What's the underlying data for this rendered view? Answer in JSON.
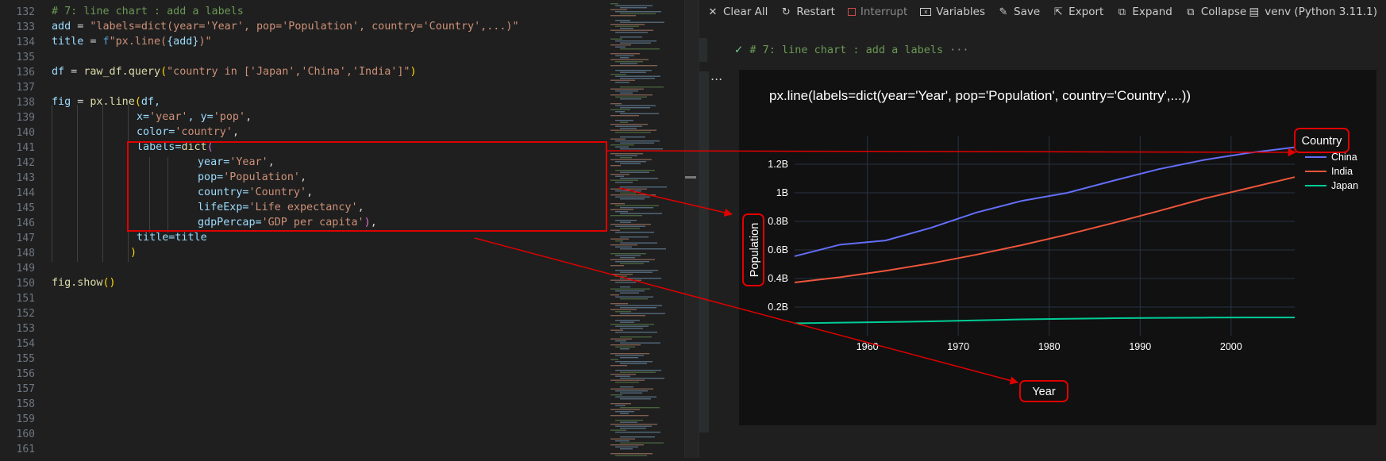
{
  "editor": {
    "line_numbers": [
      "132",
      "133",
      "134",
      "135",
      "136",
      "137",
      "138",
      "139",
      "140",
      "141",
      "142",
      "143",
      "144",
      "145",
      "146",
      "147",
      "148",
      "149",
      "150",
      "151",
      "152",
      "153",
      "154",
      "155",
      "156",
      "157",
      "158",
      "159",
      "160",
      "161"
    ],
    "lines": {
      "l132": "# 7: line chart : add a labels",
      "l133_var": "add",
      "l133_str": "\"labels=dict(year='Year', pop='Population', country='Country',...)\"",
      "l134_var": "title",
      "l134_f": "f",
      "l134_s1": "\"px.line(",
      "l134_in": "{add}",
      "l134_s2": ")\"",
      "l136_var": "df",
      "l136_fn": "raw_df.query",
      "l136_str": "\"country in ['Japan','China','India']\"",
      "l138_var": "fig",
      "l138_fn": "px.line",
      "l138_arg": "df,",
      "l139_x": "x=",
      "l139_xv": "'year'",
      "l139_y": ", y=",
      "l139_yv": "'pop'",
      "l139_end": ",",
      "l140_k": "color=",
      "l140_v": "'country'",
      "l141_k": "labels=",
      "l141_fn": "dict",
      "l142_k": "year=",
      "l142_v": "'Year'",
      "l143_k": "pop=",
      "l143_v": "'Population'",
      "l144_k": "country=",
      "l144_v": "'Country'",
      "l145_k": "lifeExp=",
      "l145_v": "'Life expectancy'",
      "l146_k": "gdpPercap=",
      "l146_v": "'GDP per capita'",
      "l147_k": "title=",
      "l147_v": "title",
      "l148": ")",
      "l150_fn": "fig.show"
    }
  },
  "toolbar": {
    "clear_all": "Clear All",
    "restart": "Restart",
    "interrupt": "Interrupt",
    "variables": "Variables",
    "save": "Save",
    "export": "Export",
    "expand": "Expand",
    "collapse": "Collapse",
    "kernel": "venv (Python 3.11.1)"
  },
  "cell": {
    "header": "# 7: line chart : add a labels",
    "header_more": "···",
    "ellipsis": "..."
  },
  "icons": {
    "clear_all": "close-icon",
    "restart": "restart-icon",
    "interrupt": "stop-icon",
    "variables": "variables-icon",
    "save": "save-icon",
    "export": "export-icon",
    "expand": "expand-icon",
    "collapse": "collapse-icon",
    "kernel": "kernel-icon",
    "check": "check-icon"
  },
  "colors": {
    "annotation": "#e00000",
    "china": "#636efa",
    "india": "#ef553b",
    "japan": "#00cc96",
    "chart_bg": "#111111"
  },
  "chart_data": {
    "type": "line",
    "title": "px.line(labels=dict(year='Year', pop='Population', country='Country',...))",
    "xlabel": "Year",
    "ylabel": "Population",
    "legend_title": "Country",
    "legend_position": "right",
    "x": [
      1952,
      1957,
      1962,
      1967,
      1972,
      1977,
      1982,
      1987,
      1992,
      1997,
      2002,
      2007
    ],
    "xlim": [
      1952,
      2007
    ],
    "ylim": [
      0,
      1.4
    ],
    "x_ticks": [
      "1960",
      "1970",
      "1980",
      "1990",
      "2000"
    ],
    "y_ticks": [
      "0.2B",
      "0.4B",
      "0.6B",
      "0.8B",
      "1B",
      "1.2B"
    ],
    "grid": true,
    "series": [
      {
        "name": "China",
        "color": "#636efa",
        "values": [
          0.556,
          0.637,
          0.666,
          0.755,
          0.862,
          0.944,
          1.0,
          1.084,
          1.165,
          1.23,
          1.28,
          1.319
        ]
      },
      {
        "name": "India",
        "color": "#ef553b",
        "values": [
          0.372,
          0.409,
          0.454,
          0.506,
          0.567,
          0.634,
          0.708,
          0.788,
          0.872,
          0.959,
          1.034,
          1.11
        ]
      },
      {
        "name": "Japan",
        "color": "#00cc96",
        "values": [
          0.086,
          0.091,
          0.095,
          0.1,
          0.107,
          0.114,
          0.118,
          0.122,
          0.124,
          0.126,
          0.127,
          0.127
        ]
      }
    ]
  }
}
